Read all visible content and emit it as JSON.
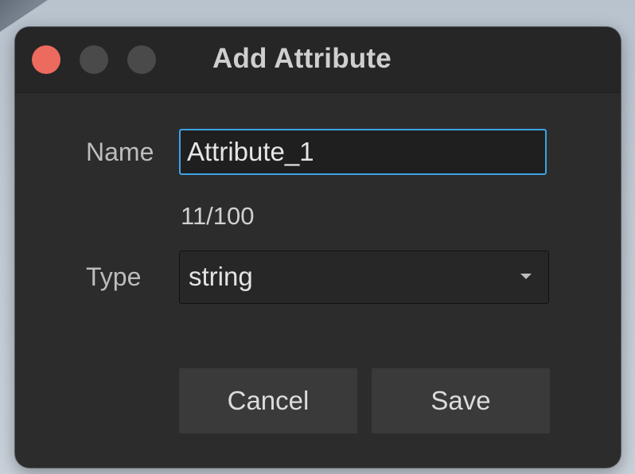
{
  "dialog": {
    "title": "Add Attribute",
    "window_controls": {
      "close_color": "#ec6a5e",
      "minimize_color": "#4a4a4a",
      "zoom_color": "#4a4a4a"
    },
    "name_field": {
      "label": "Name",
      "value": "Attribute_1",
      "char_count": "11/100"
    },
    "type_field": {
      "label": "Type",
      "selected": "string",
      "icon": "chevron-down-icon"
    },
    "buttons": {
      "cancel_label": "Cancel",
      "save_label": "Save"
    }
  },
  "colors": {
    "focus_accent": "#3ea2e6",
    "dialog_bg": "#2c2c2c"
  }
}
